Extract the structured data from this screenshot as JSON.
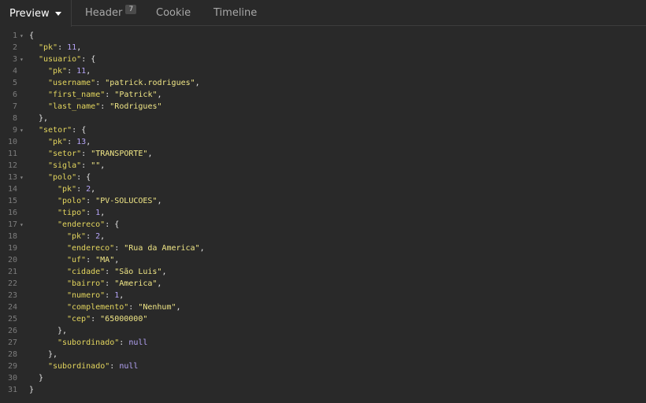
{
  "tabs": {
    "preview_label": "Preview",
    "header_label": "Header",
    "header_count": "7",
    "cookie_label": "Cookie",
    "timeline_label": "Timeline"
  },
  "colors": {
    "background": "#292929",
    "key": "#e4d65e",
    "string": "#f0e686",
    "number": "#b5a4f7",
    "line_number": "#7d7d7d"
  },
  "lines": [
    {
      "num": "1",
      "fold": true,
      "indent": 0,
      "tokens": [
        [
          "p",
          "{"
        ]
      ]
    },
    {
      "num": "2",
      "fold": false,
      "indent": 1,
      "tokens": [
        [
          "k",
          "\"pk\""
        ],
        [
          "p",
          ": "
        ],
        [
          "n",
          "11"
        ],
        [
          "p",
          ","
        ]
      ]
    },
    {
      "num": "3",
      "fold": true,
      "indent": 1,
      "tokens": [
        [
          "k",
          "\"usuario\""
        ],
        [
          "p",
          ": {"
        ]
      ]
    },
    {
      "num": "4",
      "fold": false,
      "indent": 2,
      "tokens": [
        [
          "k",
          "\"pk\""
        ],
        [
          "p",
          ": "
        ],
        [
          "n",
          "11"
        ],
        [
          "p",
          ","
        ]
      ]
    },
    {
      "num": "5",
      "fold": false,
      "indent": 2,
      "tokens": [
        [
          "k",
          "\"username\""
        ],
        [
          "p",
          ": "
        ],
        [
          "s",
          "\"patrick.rodrigues\""
        ],
        [
          "p",
          ","
        ]
      ]
    },
    {
      "num": "6",
      "fold": false,
      "indent": 2,
      "tokens": [
        [
          "k",
          "\"first_name\""
        ],
        [
          "p",
          ": "
        ],
        [
          "s",
          "\"Patrick\""
        ],
        [
          "p",
          ","
        ]
      ]
    },
    {
      "num": "7",
      "fold": false,
      "indent": 2,
      "tokens": [
        [
          "k",
          "\"last_name\""
        ],
        [
          "p",
          ": "
        ],
        [
          "s",
          "\"Rodrigues\""
        ]
      ]
    },
    {
      "num": "8",
      "fold": false,
      "indent": 1,
      "tokens": [
        [
          "p",
          "},"
        ]
      ]
    },
    {
      "num": "9",
      "fold": true,
      "indent": 1,
      "tokens": [
        [
          "k",
          "\"setor\""
        ],
        [
          "p",
          ": {"
        ]
      ]
    },
    {
      "num": "10",
      "fold": false,
      "indent": 2,
      "tokens": [
        [
          "k",
          "\"pk\""
        ],
        [
          "p",
          ": "
        ],
        [
          "n",
          "13"
        ],
        [
          "p",
          ","
        ]
      ]
    },
    {
      "num": "11",
      "fold": false,
      "indent": 2,
      "tokens": [
        [
          "k",
          "\"setor\""
        ],
        [
          "p",
          ": "
        ],
        [
          "s",
          "\"TRANSPORTE\""
        ],
        [
          "p",
          ","
        ]
      ]
    },
    {
      "num": "12",
      "fold": false,
      "indent": 2,
      "tokens": [
        [
          "k",
          "\"sigla\""
        ],
        [
          "p",
          ": "
        ],
        [
          "s",
          "\"\""
        ],
        [
          "p",
          ","
        ]
      ]
    },
    {
      "num": "13",
      "fold": true,
      "indent": 2,
      "tokens": [
        [
          "k",
          "\"polo\""
        ],
        [
          "p",
          ": {"
        ]
      ]
    },
    {
      "num": "14",
      "fold": false,
      "indent": 3,
      "tokens": [
        [
          "k",
          "\"pk\""
        ],
        [
          "p",
          ": "
        ],
        [
          "n",
          "2"
        ],
        [
          "p",
          ","
        ]
      ]
    },
    {
      "num": "15",
      "fold": false,
      "indent": 3,
      "tokens": [
        [
          "k",
          "\"polo\""
        ],
        [
          "p",
          ": "
        ],
        [
          "s",
          "\"PV-SOLUCOES\""
        ],
        [
          "p",
          ","
        ]
      ]
    },
    {
      "num": "16",
      "fold": false,
      "indent": 3,
      "tokens": [
        [
          "k",
          "\"tipo\""
        ],
        [
          "p",
          ": "
        ],
        [
          "n",
          "1"
        ],
        [
          "p",
          ","
        ]
      ]
    },
    {
      "num": "17",
      "fold": true,
      "indent": 3,
      "tokens": [
        [
          "k",
          "\"endereco\""
        ],
        [
          "p",
          ": {"
        ]
      ]
    },
    {
      "num": "18",
      "fold": false,
      "indent": 4,
      "tokens": [
        [
          "k",
          "\"pk\""
        ],
        [
          "p",
          ": "
        ],
        [
          "n",
          "2"
        ],
        [
          "p",
          ","
        ]
      ]
    },
    {
      "num": "19",
      "fold": false,
      "indent": 4,
      "tokens": [
        [
          "k",
          "\"endereco\""
        ],
        [
          "p",
          ": "
        ],
        [
          "s",
          "\"Rua da America\""
        ],
        [
          "p",
          ","
        ]
      ]
    },
    {
      "num": "20",
      "fold": false,
      "indent": 4,
      "tokens": [
        [
          "k",
          "\"uf\""
        ],
        [
          "p",
          ": "
        ],
        [
          "s",
          "\"MA\""
        ],
        [
          "p",
          ","
        ]
      ]
    },
    {
      "num": "21",
      "fold": false,
      "indent": 4,
      "tokens": [
        [
          "k",
          "\"cidade\""
        ],
        [
          "p",
          ": "
        ],
        [
          "s",
          "\"São Luis\""
        ],
        [
          "p",
          ","
        ]
      ]
    },
    {
      "num": "22",
      "fold": false,
      "indent": 4,
      "tokens": [
        [
          "k",
          "\"bairro\""
        ],
        [
          "p",
          ": "
        ],
        [
          "s",
          "\"America\""
        ],
        [
          "p",
          ","
        ]
      ]
    },
    {
      "num": "23",
      "fold": false,
      "indent": 4,
      "tokens": [
        [
          "k",
          "\"numero\""
        ],
        [
          "p",
          ": "
        ],
        [
          "n",
          "1"
        ],
        [
          "p",
          ","
        ]
      ]
    },
    {
      "num": "24",
      "fold": false,
      "indent": 4,
      "tokens": [
        [
          "k",
          "\"complemento\""
        ],
        [
          "p",
          ": "
        ],
        [
          "s",
          "\"Nenhum\""
        ],
        [
          "p",
          ","
        ]
      ]
    },
    {
      "num": "25",
      "fold": false,
      "indent": 4,
      "tokens": [
        [
          "k",
          "\"cep\""
        ],
        [
          "p",
          ": "
        ],
        [
          "s",
          "\"65000000\""
        ]
      ]
    },
    {
      "num": "26",
      "fold": false,
      "indent": 3,
      "tokens": [
        [
          "p",
          "},"
        ]
      ]
    },
    {
      "num": "27",
      "fold": false,
      "indent": 3,
      "tokens": [
        [
          "k",
          "\"subordinado\""
        ],
        [
          "p",
          ": "
        ],
        [
          "n",
          "null"
        ]
      ]
    },
    {
      "num": "28",
      "fold": false,
      "indent": 2,
      "tokens": [
        [
          "p",
          "},"
        ]
      ]
    },
    {
      "num": "29",
      "fold": false,
      "indent": 2,
      "tokens": [
        [
          "k",
          "\"subordinado\""
        ],
        [
          "p",
          ": "
        ],
        [
          "n",
          "null"
        ]
      ]
    },
    {
      "num": "30",
      "fold": false,
      "indent": 1,
      "tokens": [
        [
          "p",
          "}"
        ]
      ]
    },
    {
      "num": "31",
      "fold": false,
      "indent": 0,
      "tokens": [
        [
          "p",
          "}"
        ]
      ]
    }
  ]
}
